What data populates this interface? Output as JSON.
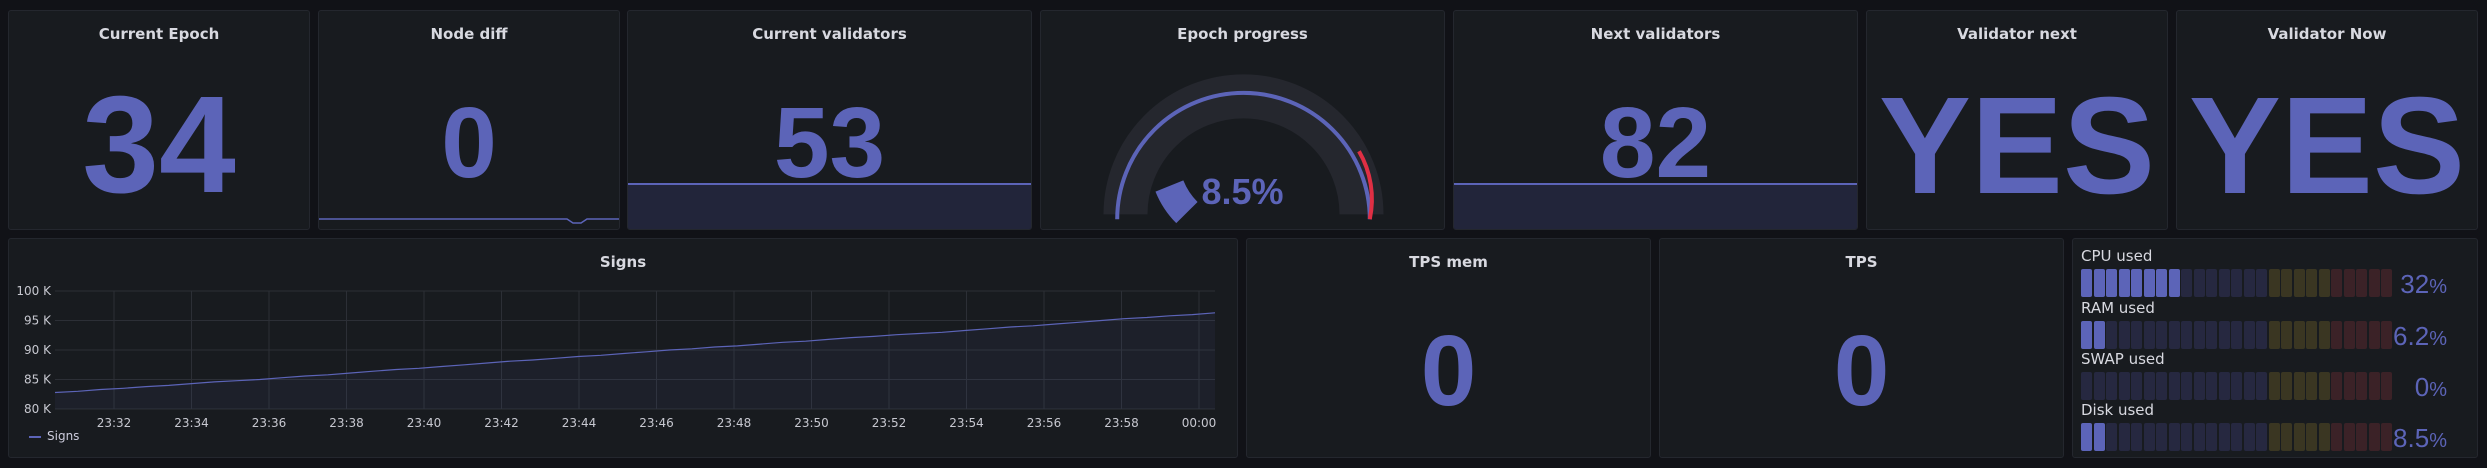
{
  "panels": {
    "current_epoch": {
      "title": "Current Epoch",
      "value": "34"
    },
    "node_diff": {
      "title": "Node diff",
      "value": "0"
    },
    "current_validators": {
      "title": "Current validators",
      "value": "53"
    },
    "epoch_progress": {
      "title": "Epoch progress",
      "value": "8.5%",
      "percent": 8.5
    },
    "next_validators": {
      "title": "Next validators",
      "value": "82"
    },
    "validator_next": {
      "title": "Validator next",
      "value": "YES"
    },
    "validator_now": {
      "title": "Validator Now",
      "value": "YES"
    },
    "signs": {
      "title": "Signs",
      "legend": "Signs"
    },
    "tps_mem": {
      "title": "TPS mem",
      "value": "0"
    },
    "tps": {
      "title": "TPS",
      "value": "0"
    },
    "resources": {
      "items": [
        {
          "label": "CPU used",
          "value": "32",
          "unit": "%",
          "percent": 32
        },
        {
          "label": "RAM used",
          "value": "6.2",
          "unit": "%",
          "percent": 6.2
        },
        {
          "label": "SWAP used",
          "value": "0",
          "unit": "%",
          "percent": 0
        },
        {
          "label": "Disk used",
          "value": "8.5",
          "unit": "%",
          "percent": 8.5
        }
      ]
    }
  },
  "colors": {
    "accent": "#5c64b8",
    "threshold_red": "#e02f44",
    "panel_bg": "#181b1f",
    "page_bg": "#111217"
  },
  "chart_data": {
    "type": "line",
    "title": "Signs",
    "series": [
      {
        "name": "Signs",
        "values": [
          82800,
          83000,
          83300,
          83500,
          83800,
          84000,
          84300,
          84600,
          84800,
          85000,
          85300,
          85600,
          85800,
          86100,
          86400,
          86700,
          86900,
          87200,
          87500,
          87800,
          88100,
          88300,
          88600,
          88900,
          89100,
          89400,
          89700,
          90000,
          90200,
          90500,
          90700,
          91000,
          91300,
          91500,
          91800,
          92100,
          92300,
          92600,
          92800,
          93000,
          93300,
          93600,
          93900,
          94100,
          94400,
          94700,
          95000,
          95300,
          95500,
          95800,
          96000,
          96300
        ]
      }
    ],
    "x_ticks": [
      "23:32",
      "23:34",
      "23:36",
      "23:38",
      "23:40",
      "23:42",
      "23:44",
      "23:46",
      "23:48",
      "23:50",
      "23:52",
      "23:54",
      "23:56",
      "23:58",
      "00:00"
    ],
    "y_ticks": [
      "80 K",
      "85 K",
      "90 K",
      "95 K",
      "100 K"
    ],
    "ylim": [
      80000,
      100000
    ],
    "grid": true,
    "legend": "bottom-left"
  }
}
